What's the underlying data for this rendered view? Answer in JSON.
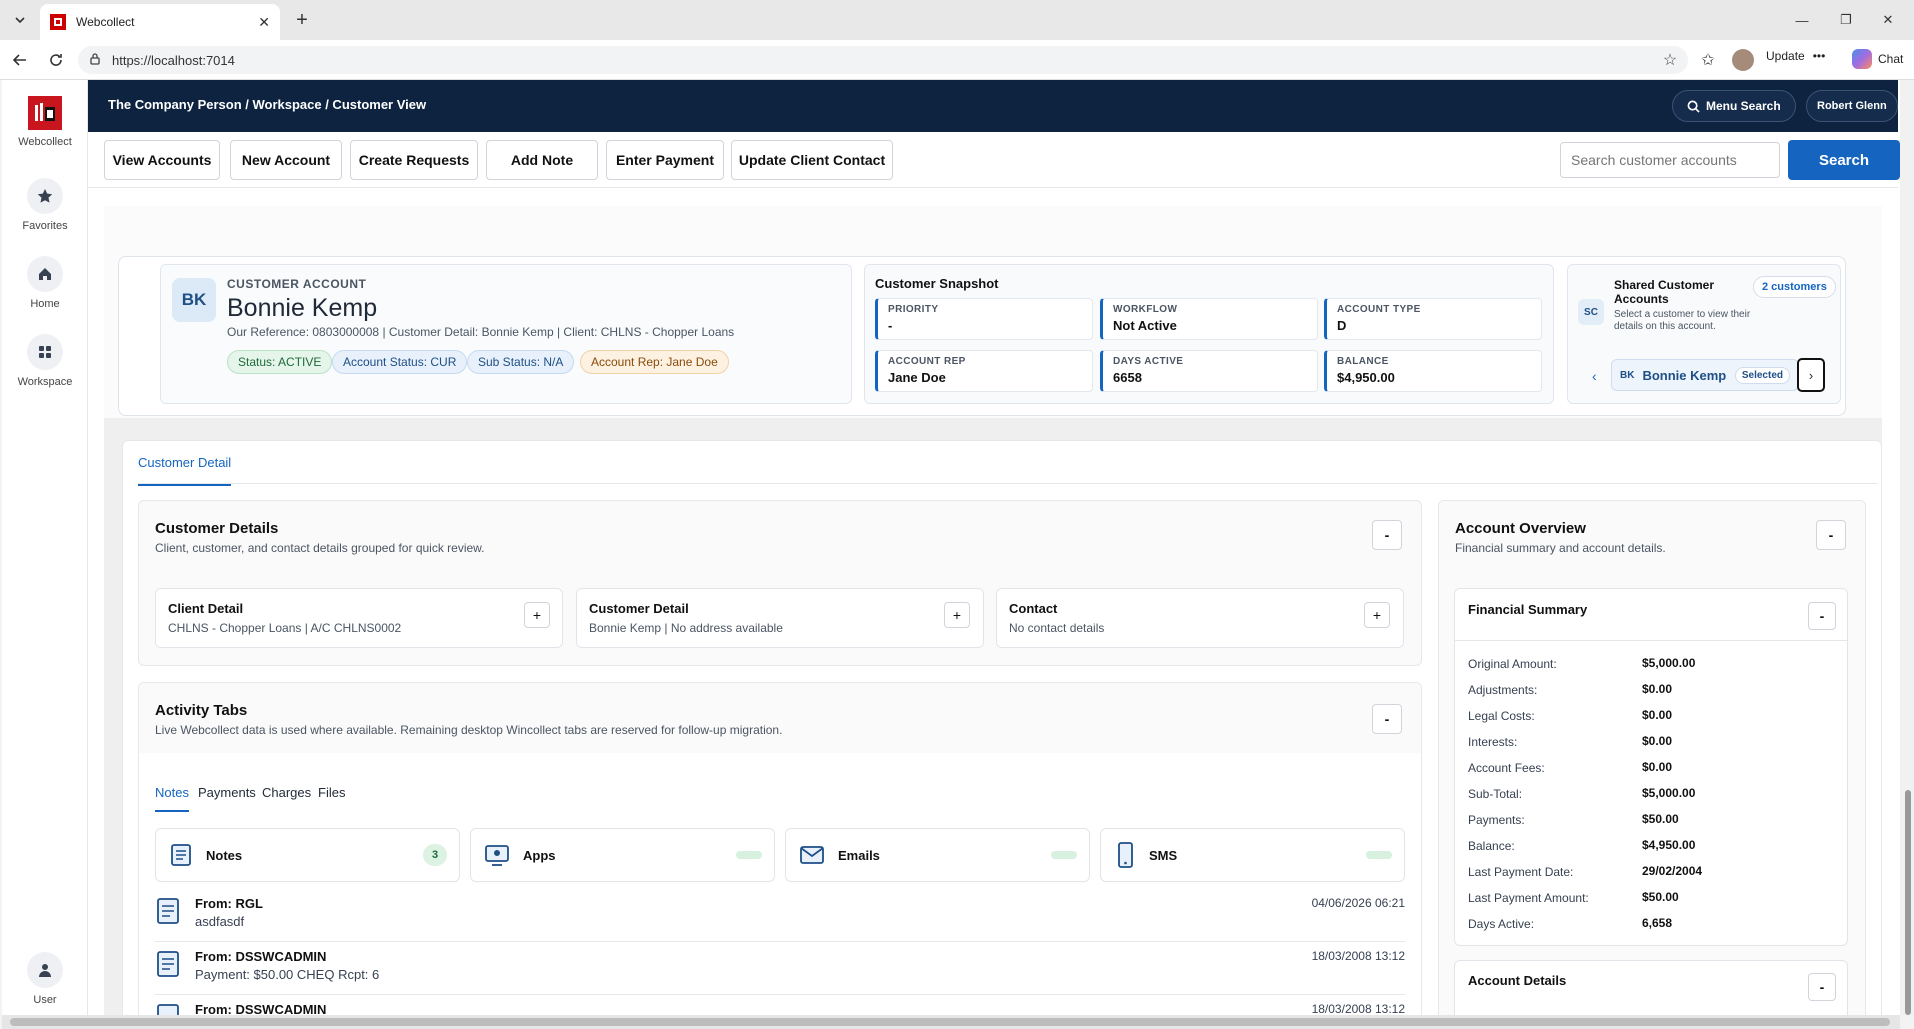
{
  "browser": {
    "tab_title": "Webcollect",
    "url": "https://localhost:7014",
    "update_label": "Update",
    "chat_label": "Chat"
  },
  "nav": {
    "brand": "Webcollect",
    "items": [
      {
        "label": "Favorites",
        "icon": "star-icon"
      },
      {
        "label": "Home",
        "icon": "home-icon"
      },
      {
        "label": "Workspace",
        "icon": "grid-icon"
      },
      {
        "label": "User",
        "icon": "user-icon"
      }
    ]
  },
  "header": {
    "breadcrumb": "The Company Person / Workspace / Customer View",
    "menu_search": "Menu Search",
    "user": "Robert Glenn"
  },
  "actions": [
    "View Accounts",
    "New Account",
    "Create Requests",
    "Add Note",
    "Enter Payment",
    "Update Client Contact"
  ],
  "search": {
    "placeholder": "Search customer accounts",
    "button": "Search"
  },
  "customer": {
    "initials": "BK",
    "label": "CUSTOMER ACCOUNT",
    "name": "Bonnie Kemp",
    "reference": "Our Reference: 0803000008 | Customer Detail: Bonnie Kemp | Client: CHLNS - Chopper Loans",
    "pills": [
      "Status: ACTIVE",
      "Account Status: CUR",
      "Sub Status: N/A",
      "Account Rep: Jane Doe"
    ]
  },
  "snapshot": {
    "title": "Customer Snapshot",
    "tiles": [
      {
        "k": "PRIORITY",
        "v": "-"
      },
      {
        "k": "WORKFLOW",
        "v": "Not Active"
      },
      {
        "k": "ACCOUNT TYPE",
        "v": "D"
      },
      {
        "k": "ACCOUNT REP",
        "v": "Jane Doe"
      },
      {
        "k": "DAYS ACTIVE",
        "v": "6658"
      },
      {
        "k": "BALANCE",
        "v": "$4,950.00"
      }
    ]
  },
  "shared": {
    "initials": "SC",
    "title": "Shared Customer Accounts",
    "count": "2 customers",
    "desc": "Select a customer to view their details on this account.",
    "item_initials": "BK",
    "item_name": "Bonnie Kemp",
    "item_selected": "Selected",
    "prev": "‹",
    "next": "›"
  },
  "panel_tab": "Customer Detail",
  "customer_details": {
    "title": "Customer Details",
    "subtitle": "Client, customer, and contact details grouped for quick review.",
    "collapse": "-",
    "cards": [
      {
        "title": "Client Detail",
        "sub": "CHLNS - Chopper Loans | A/C CHLNS0002"
      },
      {
        "title": "Customer Detail",
        "sub": "Bonnie Kemp | No address available"
      },
      {
        "title": "Contact",
        "sub": "No contact details"
      }
    ],
    "expand": "+"
  },
  "activity": {
    "title": "Activity Tabs",
    "subtitle": "Live Webcollect data is used where available. Remaining desktop Wincollect tabs are reserved for follow-up migration.",
    "collapse": "-",
    "tabs": [
      "Notes",
      "Payments",
      "Charges",
      "Files"
    ],
    "summary": [
      {
        "label": "Notes",
        "badge": "3",
        "icon": "notes-icon"
      },
      {
        "label": "Apps",
        "icon": "apps-icon"
      },
      {
        "label": "Emails",
        "icon": "mail-icon"
      },
      {
        "label": "SMS",
        "icon": "phone-icon"
      }
    ],
    "notes": [
      {
        "from": "From: RGL",
        "body": "asdfasdf",
        "date": "04/06/2026 06:21"
      },
      {
        "from": "From: DSSWCADMIN",
        "body": "Payment: $50.00 CHEQ Rcpt: 6",
        "date": "18/03/2008 13:12"
      },
      {
        "from": "From: DSSWCADMIN",
        "body": "",
        "date": "18/03/2008 13:12"
      }
    ]
  },
  "overview": {
    "title": "Account Overview",
    "subtitle": "Financial summary and account details.",
    "collapse": "-",
    "financial_title": "Financial Summary",
    "rows": [
      {
        "k": "Original Amount:",
        "v": "$5,000.00"
      },
      {
        "k": "Adjustments:",
        "v": "$0.00"
      },
      {
        "k": "Legal Costs:",
        "v": "$0.00"
      },
      {
        "k": "Interests:",
        "v": "$0.00"
      },
      {
        "k": "Account Fees:",
        "v": "$0.00"
      },
      {
        "k": "Sub-Total:",
        "v": "$5,000.00"
      },
      {
        "k": "Payments:",
        "v": "$50.00"
      },
      {
        "k": "Balance:",
        "v": "$4,950.00"
      },
      {
        "k": "Last Payment Date:",
        "v": "29/02/2004"
      },
      {
        "k": "Last Payment Amount:",
        "v": "$50.00"
      },
      {
        "k": "Days Active:",
        "v": "6,658"
      }
    ],
    "details_title": "Account Details"
  }
}
